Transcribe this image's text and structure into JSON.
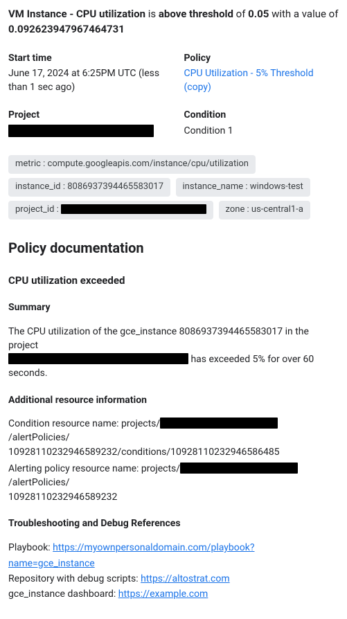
{
  "title": {
    "a": "VM Instance - CPU utilization",
    "b": " is ",
    "c": "above threshold",
    "d": " of ",
    "e": "0.05",
    "f": " with a value of ",
    "g": "0.092623947967464731"
  },
  "meta": {
    "start_label": "Start time",
    "start_value": "June 17, 2024 at 6:25PM UTC (less than 1 sec ago)",
    "policy_label": "Policy",
    "policy_link": "CPU Utilization - 5% Threshold (copy)",
    "project_label": "Project",
    "condition_label": "Condition",
    "condition_value": "Condition 1"
  },
  "chips": {
    "metric": "metric : compute.googleapis.com/instance/cpu/utilization",
    "instance_id": "instance_id : 8086937394465583017",
    "instance_name": "instance_name : windows-test",
    "project_id_prefix": "project_id : ",
    "zone": "zone : us-central1-a"
  },
  "doc": {
    "heading": "Policy documentation",
    "sub": "CPU utilization exceeded",
    "summary_h": "Summary",
    "summary_a": "The CPU utilization of the gce_instance 8086937394465583017 in the project ",
    "summary_b": " has exceeded 5% for over 60 seconds.",
    "addl_h": "Additional resource information",
    "cond_a": "Condition resource name: projects/",
    "cond_b": "/alertPolicies/",
    "cond_c": "10928110232946589232/conditions/10928110232946586485",
    "pol_a": "Alerting policy resource name: projects/",
    "pol_b": "/alertPolicies/",
    "pol_c": "10928110232946589232",
    "trouble_h": "Troubleshooting and Debug References",
    "playbook_l": "Playbook: ",
    "playbook_u": "https://myownpersonaldomain.com/playbook?name=gce_instance",
    "repo_l": "Repository with debug scripts: ",
    "repo_u": "https://altostrat.com",
    "dash_l": "gce_instance dashboard: ",
    "dash_u": "https://example.com"
  }
}
